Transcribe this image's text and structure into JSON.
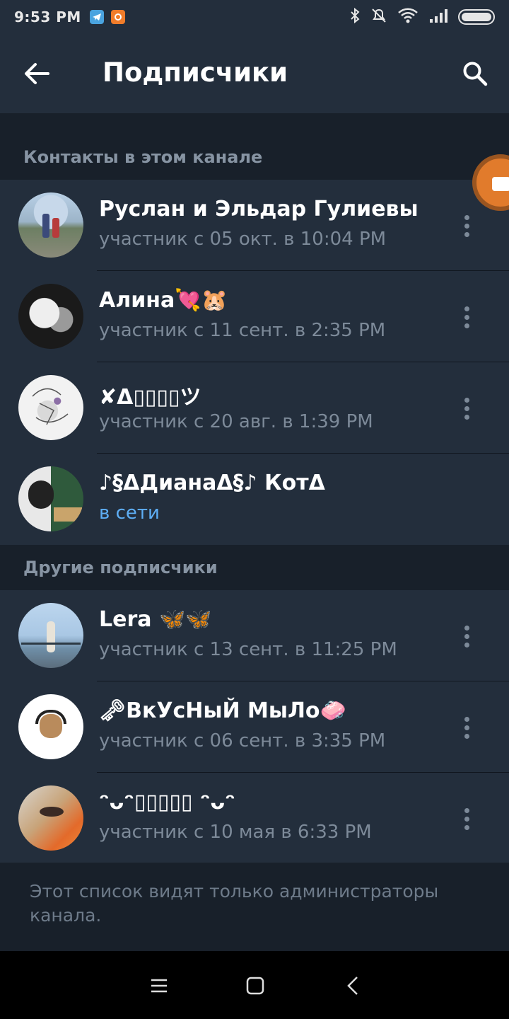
{
  "status_bar": {
    "time": "9:53 PM",
    "left_icons": [
      "telegram-icon",
      "record-icon"
    ],
    "right_icons": [
      "bluetooth-icon",
      "mute-icon",
      "wifi-icon",
      "signal-icon",
      "battery-icon"
    ]
  },
  "header": {
    "title": "Подписчики",
    "back_icon": "arrow-left-icon",
    "search_icon": "search-icon"
  },
  "sections": [
    {
      "title": "Контакты в этом канале",
      "members": [
        {
          "name": "Руслан и Эльдар Гулиевы",
          "subtitle": "участник с 05 окт. в 10:04 PM",
          "online": false,
          "has_menu": true
        },
        {
          "name": "Алина💘🐹",
          "subtitle": "участник с 11 сент. в 2:35 PM",
          "online": false,
          "has_menu": true
        },
        {
          "name": "✘Δ▯▯▯▯ツ",
          "subtitle": "участник с 20 авг. в 1:39 PM",
          "online": false,
          "has_menu": true
        },
        {
          "name": "♪§ΔДианаΔ§♪ КотΔ",
          "subtitle": "в сети",
          "online": true,
          "has_menu": false
        }
      ]
    },
    {
      "title": "Другие подписчики",
      "members": [
        {
          "name": "Lera 🦋🦋",
          "subtitle": "участник с 13 сент. в 11:25 PM",
          "online": false,
          "has_menu": true
        },
        {
          "name": "🗝ВкУсНыЙ МыЛо🧼",
          "subtitle": "участник с 06 сент. в 3:35 PM",
          "online": false,
          "has_menu": true
        },
        {
          "name": "ᵔᴗᵔ▯▯▯▯▯ ᵔᴗᵔ",
          "subtitle": "участник с 10 мая в 6:33 PM",
          "online": false,
          "has_menu": true
        }
      ]
    }
  ],
  "footer_note": "Этот список видят только администраторы канала.",
  "nav_bar": {
    "icons": [
      "menu-icon",
      "home-square-icon",
      "back-chevron-icon"
    ]
  },
  "colors": {
    "background": "#1d2733",
    "header": "#232e3c",
    "section_bg": "#18202a",
    "online": "#5eaef5",
    "secondary_text": "#7d8a99"
  }
}
